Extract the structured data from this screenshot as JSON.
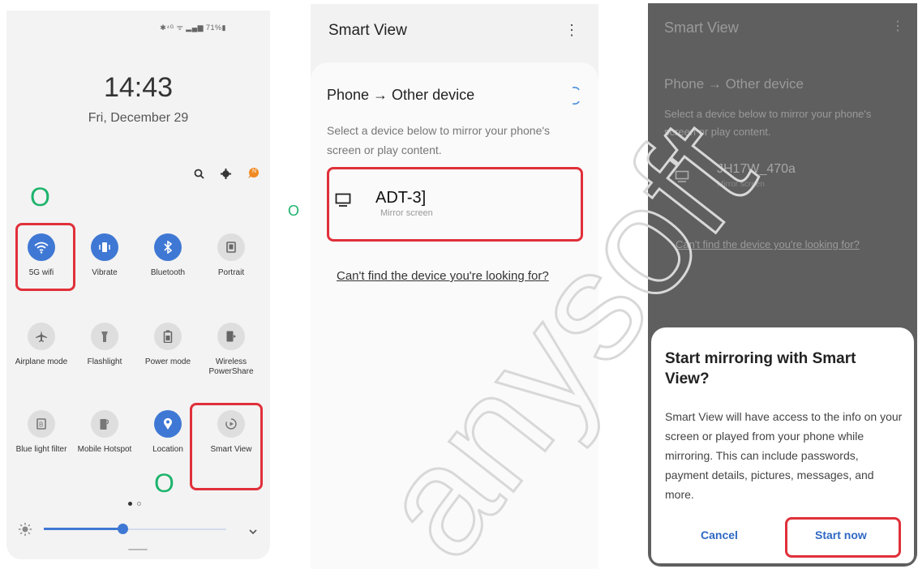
{
  "colors": {
    "accent": "#3f78d4",
    "highlight": "#e0303a",
    "marker": "#1db36b",
    "link": "#2f68c4"
  },
  "quick_panel": {
    "status_text": "✱⁴ᴳ ᯤ ▂▄▆ 71%▮",
    "time": "14:43",
    "date": "Fri, December 29",
    "top_icons": [
      "search-icon",
      "gear-icon",
      "notification-badge-icon"
    ],
    "badge_text": "N",
    "tiles": [
      {
        "label": "5G wifi",
        "icon": "wifi-icon",
        "state": "on"
      },
      {
        "label": "Vibrate",
        "icon": "vibrate-icon",
        "state": "on"
      },
      {
        "label": "Bluetooth",
        "icon": "bluetooth-icon",
        "state": "on"
      },
      {
        "label": "Portrait",
        "icon": "portrait-icon",
        "state": "off"
      },
      {
        "label": "Airplane mode",
        "icon": "airplane-icon",
        "state": "off"
      },
      {
        "label": "Flashlight",
        "icon": "flashlight-icon",
        "state": "off"
      },
      {
        "label": "Power mode",
        "icon": "battery-icon",
        "state": "off"
      },
      {
        "label": "Wireless PowerShare",
        "icon": "powershare-icon",
        "state": "off"
      },
      {
        "label": "Blue light filter",
        "icon": "blue-light-icon",
        "state": "off"
      },
      {
        "label": "Mobile Hotspot",
        "icon": "hotspot-icon",
        "state": "off"
      },
      {
        "label": "Location",
        "icon": "location-icon",
        "state": "on"
      },
      {
        "label": "Smart View",
        "icon": "smart-view-icon",
        "state": "off"
      }
    ],
    "page_indicator": {
      "pages": 2,
      "current": 1
    },
    "brightness_level": 0.43
  },
  "markers": [
    "O",
    "O",
    "O",
    "O"
  ],
  "smart_view": {
    "title": "Smart View",
    "heading": "Phone → Other device",
    "description": "Select a device below to mirror your phone's screen or play content.",
    "device": {
      "name": "ADT-3]",
      "subtitle": "Mirror screen"
    },
    "help_link": "Can't find the device you're looking for?"
  },
  "mirror_dialog": {
    "background": {
      "title": "Smart View",
      "heading": "Phone → Other device",
      "description": "Select a device below to mirror your phone's screen or play content.",
      "device_name": "JH17W_470a",
      "device_subtitle": "Mirror screen",
      "help_link": "Can't find the device you're looking for?"
    },
    "title": "Start mirroring with Smart View?",
    "body": "Smart View will have access to the info on your screen or played from your phone while mirroring. This can include passwords, payment details, pictures, messages, and more.",
    "cancel_label": "Cancel",
    "confirm_label": "Start now"
  },
  "watermark": "anysoft"
}
